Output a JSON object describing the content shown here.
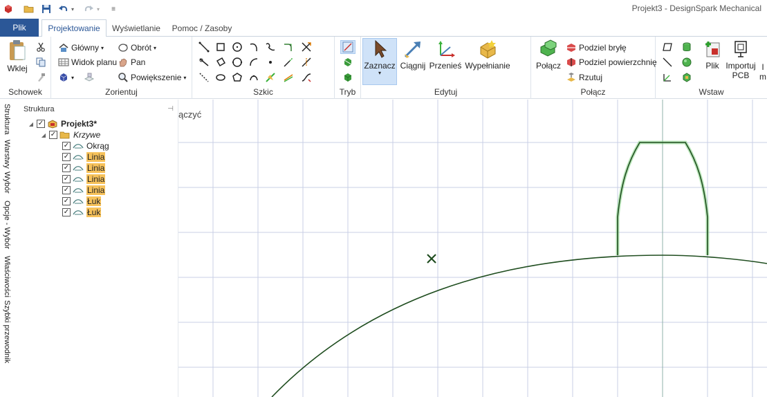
{
  "window": {
    "title": "Projekt3 - DesignSpark Mechanical"
  },
  "tabs": {
    "file": "Plik",
    "items": [
      {
        "label": "Projektowanie",
        "active": true
      },
      {
        "label": "Wyświetlanie",
        "active": false
      },
      {
        "label": "Pomoc / Zasoby",
        "active": false
      }
    ]
  },
  "ribbon": {
    "clipboard": {
      "label": "Schowek",
      "paste": "Wklej"
    },
    "orient": {
      "label": "Zorientuj",
      "home": "Główny",
      "plan_view": "Widok planu",
      "rotate": "Obrót",
      "pan": "Pan",
      "zoom": "Powiększenie"
    },
    "sketch": {
      "label": "Szkic"
    },
    "mode": {
      "label": "Tryb"
    },
    "edit": {
      "label": "Edytuj",
      "select": "Zaznacz",
      "pull": "Ciągnij",
      "move": "Przenieś",
      "fill": "Wypełnianie"
    },
    "combine": {
      "label": "Połącz",
      "combine_btn": "Połącz",
      "split_body": "Podziel bryłę",
      "split_face": "Podziel powierzchnię",
      "project": "Rzutuj"
    },
    "insert": {
      "label": "Wstaw",
      "file": "Plik",
      "import_pcb_line1": "Importuj",
      "import_pcb_line2": "PCB",
      "cut_off_line1": "I",
      "cut_off_line2": "m"
    }
  },
  "side_tabs": [
    "Struktura",
    "Warstwy",
    "Wybór",
    "Opcje - Wybór",
    "Właściwości",
    "Szybki przewodnik"
  ],
  "structure": {
    "title": "Struktura",
    "tree": [
      {
        "label": "Projekt3*",
        "level": 0,
        "bold": true,
        "highlight": false
      },
      {
        "label": "Krzywe",
        "level": 1,
        "italic": true,
        "highlight": false
      },
      {
        "label": "Okrąg",
        "level": 2,
        "highlight": false
      },
      {
        "label": "Linia",
        "level": 2,
        "highlight": true
      },
      {
        "label": "Linia",
        "level": 2,
        "highlight": true
      },
      {
        "label": "Linia",
        "level": 2,
        "highlight": true
      },
      {
        "label": "Linia",
        "level": 2,
        "highlight": true
      },
      {
        "label": "Łuk",
        "level": 2,
        "highlight": true
      },
      {
        "label": "Łuk",
        "level": 2,
        "highlight": true
      }
    ]
  },
  "canvas": {
    "hint": "ączyć",
    "curve_color": "#1f4d1f",
    "highlight_color": "#3bb13b",
    "grid_color": "#c9cfe6"
  },
  "colors": {
    "file_tab": "#2b5797",
    "accent": "#2b5797",
    "tree_highlight": "#f7c25b",
    "selected_tool": "#cfe2f8"
  }
}
